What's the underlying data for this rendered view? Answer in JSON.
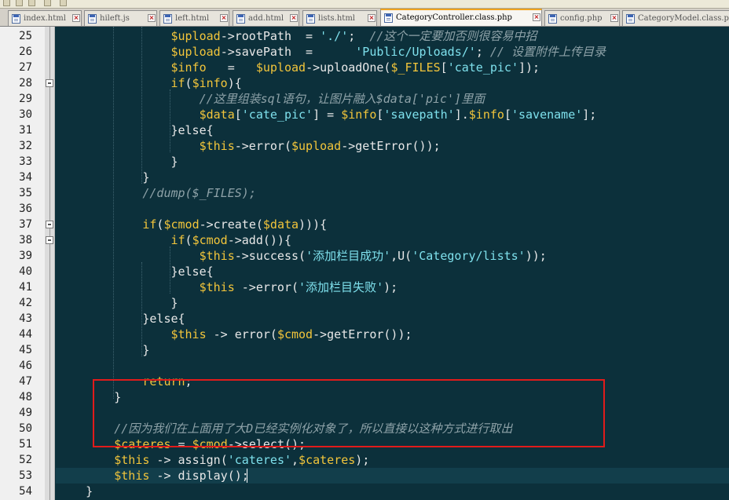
{
  "tabs": [
    {
      "label": "index.html",
      "active": false
    },
    {
      "label": "hileft.js",
      "active": false
    },
    {
      "label": "left.html",
      "active": false
    },
    {
      "label": "add.html",
      "active": false
    },
    {
      "label": "lists.html",
      "active": false
    },
    {
      "label": "CategoryController.class.php",
      "active": true
    },
    {
      "label": "config.php",
      "active": false
    },
    {
      "label": "CategoryModel.class.php",
      "active": false
    }
  ],
  "colors": {
    "editor_bg": "#0c303b",
    "variable": "#f2c53b",
    "string": "#7ee0ec",
    "comment": "#8ea2a8",
    "highlight_box": "#e11b1b"
  },
  "code": {
    "current_line": 53,
    "lines": [
      {
        "n": "25",
        "tokens": [
          [
            "v",
            "$upload"
          ],
          [
            "o",
            "->rootPath  = "
          ],
          [
            "s",
            "'./'"
          ],
          [
            "o",
            ";  "
          ],
          [
            "c",
            "//这个一定要加否则很容易中招"
          ]
        ]
      },
      {
        "n": "26",
        "tokens": [
          [
            "v",
            "$upload"
          ],
          [
            "o",
            "->savePath  =      "
          ],
          [
            "s",
            "'Public/Uploads/'"
          ],
          [
            "o",
            "; "
          ],
          [
            "c",
            "// 设置附件上传目录"
          ]
        ]
      },
      {
        "n": "27",
        "tokens": [
          [
            "v",
            "$info"
          ],
          [
            "o",
            "   =   "
          ],
          [
            "v",
            "$upload"
          ],
          [
            "o",
            "->uploadOne("
          ],
          [
            "v",
            "$_FILES"
          ],
          [
            "o",
            "["
          ],
          [
            "s",
            "'cate_pic'"
          ],
          [
            "o",
            "]);"
          ]
        ]
      },
      {
        "n": "28",
        "tokens": [
          [
            "k",
            "if"
          ],
          [
            "o",
            "("
          ],
          [
            "v",
            "$info"
          ],
          [
            "o",
            "){"
          ]
        ]
      },
      {
        "n": "29",
        "tokens": [
          [
            "c",
            "//这里组装sql语句，让图片融入$data['pic']里面"
          ]
        ]
      },
      {
        "n": "30",
        "tokens": [
          [
            "v",
            "$data"
          ],
          [
            "o",
            "["
          ],
          [
            "s",
            "'cate_pic'"
          ],
          [
            "o",
            "] = "
          ],
          [
            "v",
            "$info"
          ],
          [
            "o",
            "["
          ],
          [
            "s",
            "'savepath'"
          ],
          [
            "o",
            "]."
          ],
          [
            "v",
            "$info"
          ],
          [
            "o",
            "["
          ],
          [
            "s",
            "'savename'"
          ],
          [
            "o",
            "];"
          ]
        ]
      },
      {
        "n": "31",
        "tokens": [
          [
            "o",
            "}else{"
          ]
        ]
      },
      {
        "n": "32",
        "tokens": [
          [
            "v",
            "$this"
          ],
          [
            "o",
            "->error("
          ],
          [
            "v",
            "$upload"
          ],
          [
            "o",
            "->getError());"
          ]
        ]
      },
      {
        "n": "33",
        "tokens": [
          [
            "o",
            "}"
          ]
        ]
      },
      {
        "n": "34",
        "tokens": [
          [
            "o",
            "}"
          ]
        ]
      },
      {
        "n": "35",
        "tokens": [
          [
            "c",
            "//dump($_FILES);"
          ]
        ]
      },
      {
        "n": "36",
        "tokens": []
      },
      {
        "n": "37",
        "tokens": [
          [
            "k",
            "if"
          ],
          [
            "o",
            "("
          ],
          [
            "v",
            "$cmod"
          ],
          [
            "o",
            "->create("
          ],
          [
            "v",
            "$data"
          ],
          [
            "o",
            "))){"
          ]
        ]
      },
      {
        "n": "38",
        "tokens": [
          [
            "k",
            "if"
          ],
          [
            "o",
            "("
          ],
          [
            "v",
            "$cmod"
          ],
          [
            "o",
            "->add()){"
          ]
        ]
      },
      {
        "n": "39",
        "tokens": [
          [
            "v",
            "$this"
          ],
          [
            "o",
            "->success("
          ],
          [
            "s",
            "'添加栏目成功'"
          ],
          [
            "o",
            ",U("
          ],
          [
            "s",
            "'Category/lists'"
          ],
          [
            "o",
            "));"
          ]
        ]
      },
      {
        "n": "40",
        "tokens": [
          [
            "o",
            "}else{"
          ]
        ]
      },
      {
        "n": "41",
        "tokens": [
          [
            "v",
            "$this"
          ],
          [
            "o",
            " ->error("
          ],
          [
            "s",
            "'添加栏目失败'"
          ],
          [
            "o",
            ");"
          ]
        ]
      },
      {
        "n": "42",
        "tokens": [
          [
            "o",
            "}"
          ]
        ]
      },
      {
        "n": "43",
        "tokens": [
          [
            "o",
            "}else{"
          ]
        ]
      },
      {
        "n": "44",
        "tokens": [
          [
            "v",
            "$this"
          ],
          [
            "o",
            " -> error("
          ],
          [
            "v",
            "$cmod"
          ],
          [
            "o",
            "->getError());"
          ]
        ]
      },
      {
        "n": "45",
        "tokens": [
          [
            "o",
            "}"
          ]
        ]
      },
      {
        "n": "46",
        "tokens": []
      },
      {
        "n": "47",
        "tokens": [
          [
            "k",
            "return"
          ],
          [
            "o",
            ";"
          ]
        ]
      },
      {
        "n": "48",
        "tokens": [
          [
            "o",
            "}"
          ]
        ]
      },
      {
        "n": "49",
        "tokens": []
      },
      {
        "n": "50",
        "tokens": [
          [
            "c",
            "//因为我们在上面用了大D已经实例化对象了，所以直接以这种方式进行取出"
          ]
        ]
      },
      {
        "n": "51",
        "tokens": [
          [
            "v",
            "$cateres"
          ],
          [
            "o",
            " = "
          ],
          [
            "v",
            "$cmod"
          ],
          [
            "o",
            "->select();"
          ]
        ]
      },
      {
        "n": "52",
        "tokens": [
          [
            "v",
            "$this"
          ],
          [
            "o",
            " -> assign("
          ],
          [
            "s",
            "'cateres'"
          ],
          [
            "o",
            ","
          ],
          [
            "v",
            "$cateres"
          ],
          [
            "o",
            ");"
          ]
        ]
      },
      {
        "n": "53",
        "tokens": [
          [
            "v",
            "$this"
          ],
          [
            "o",
            " -> display();"
          ]
        ]
      },
      {
        "n": "54",
        "tokens": [
          [
            "o",
            "}"
          ]
        ]
      }
    ]
  }
}
